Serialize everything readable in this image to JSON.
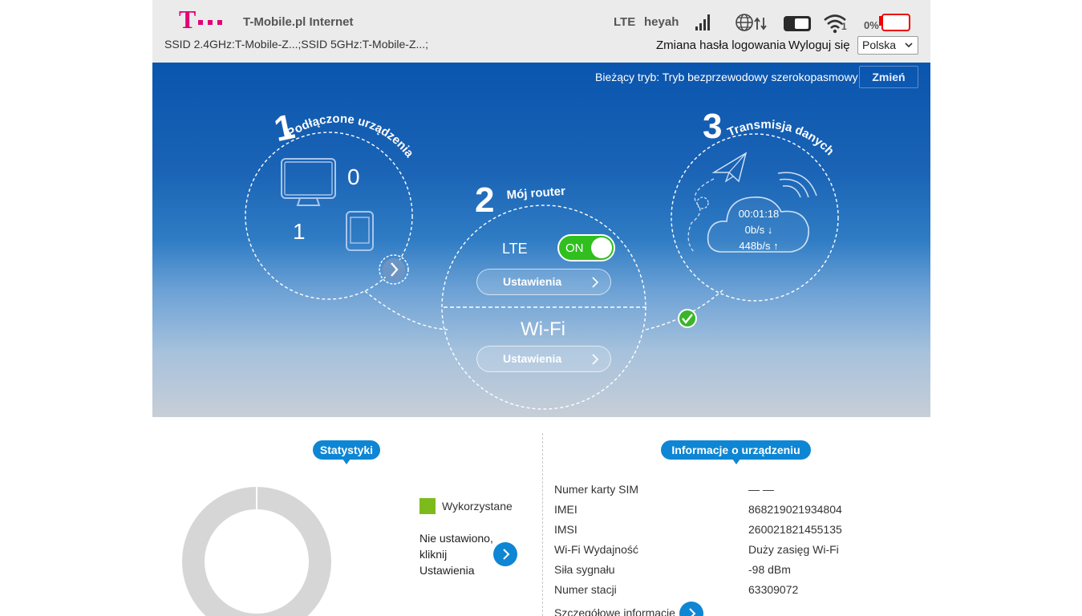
{
  "header": {
    "brand_name": "T-Mobile.pl Internet",
    "ssid_text": "SSID 2.4GHz:T-Mobile-Z...;SSID 5GHz:T-Mobile-Z...;",
    "network_type": "LTE",
    "operator": "heyah",
    "roaming_badge": "1",
    "battery_percent": "0%",
    "change_password": "Zmiana hasła logowania",
    "logout": "Wyloguj się",
    "language": "Polska",
    "brand_color": "#e20074"
  },
  "hero": {
    "mode_label": "Bieżący tryb: Tryb bezprzewodowy szerokopasmowy",
    "mode_button": "Zmień",
    "section1": {
      "number": "1",
      "title": "Podłączone urządzenia",
      "computers_count": "0",
      "phones_count": "1"
    },
    "section2": {
      "number": "2",
      "title": "Mój router",
      "lte_label": "LTE",
      "toggle_label": "ON",
      "settings_label": "Ustawienia",
      "wifi_label": "Wi-Fi",
      "wifi_settings_label": "Ustawienia"
    },
    "section3": {
      "number": "3",
      "title": "Transmisja danych",
      "duration": "00:01:18",
      "download": "0b/s ↓",
      "upload": "448b/s ↑"
    }
  },
  "stats": {
    "title": "Statystyki",
    "legend_used": "Wykorzystane",
    "used_fraction": 0,
    "used_color": "#7dbb1d",
    "remaining_color": "#d6d6d6",
    "not_set_lines": [
      "Nie ustawiono,",
      "kliknij",
      "Ustawienia"
    ]
  },
  "device_info": {
    "title": "Informacje o urządzeniu",
    "rows": [
      {
        "label": "Numer karty SIM",
        "value": "— —"
      },
      {
        "label": "IMEI",
        "value": "868219021934804"
      },
      {
        "label": "IMSI",
        "value": "260021821455135"
      },
      {
        "label": "Wi-Fi Wydajność",
        "value": "Duży zasięg Wi-Fi"
      },
      {
        "label": "Siła sygnału",
        "value": "-98 dBm"
      },
      {
        "label": "Numer stacji",
        "value": "63309072"
      }
    ],
    "details_label": "Szczegółowe informacje"
  }
}
